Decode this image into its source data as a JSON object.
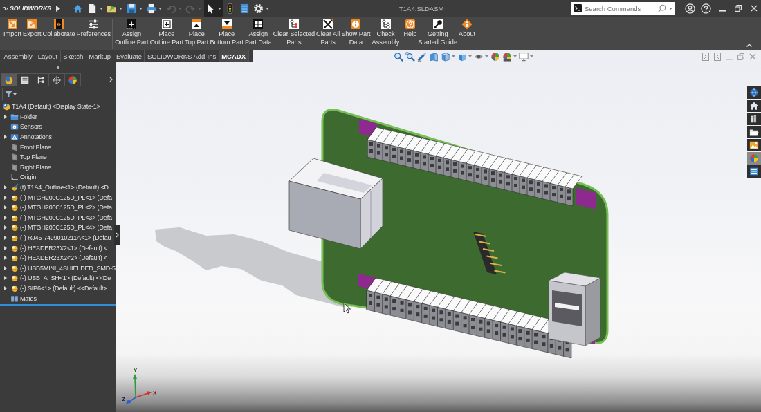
{
  "title_bar": {
    "app_name": "SOLIDWORKS",
    "quick_access": [
      {
        "disabled": false,
        "selected": false
      },
      {
        "disabled": false,
        "selected": false
      },
      {
        "disabled": false,
        "selected": false
      },
      {
        "disabled": false,
        "selected": false
      },
      {
        "disabled": false,
        "selected": false
      },
      {
        "disabled": true,
        "selected": false
      },
      {
        "disabled": true,
        "selected": false
      },
      {
        "disabled": false,
        "selected": true
      },
      {
        "disabled": false,
        "selected": false
      },
      {
        "disabled": false,
        "selected": false
      },
      {
        "disabled": false,
        "selected": false
      }
    ],
    "document_title": "T1A4.SLDASM",
    "search": {
      "placeholder": "Search Commands"
    }
  },
  "ribbon": {
    "groups": [
      {
        "buttons": [
          {
            "label": "Import"
          },
          {
            "label": "Export"
          },
          {
            "label": "Collaborate"
          },
          {
            "label": "Preferences"
          }
        ]
      },
      {
        "buttons": [
          {
            "label": "Assign\nOutline Part"
          },
          {
            "label": "Place\nOutline Part"
          },
          {
            "label": "Place\nTop Part"
          },
          {
            "label": "Place\nBottom Part"
          },
          {
            "label": "Assign\nPart Data"
          },
          {
            "label": "Clear Selected\nParts"
          },
          {
            "label": "Clear All\nParts"
          },
          {
            "label": "Show Part\nData"
          },
          {
            "label": "Check\nAssembly"
          }
        ]
      },
      {
        "buttons": [
          {
            "label": "Help"
          },
          {
            "label": "Getting\nStarted Guide"
          },
          {
            "label": "About"
          }
        ]
      }
    ]
  },
  "tabs": [
    {
      "label": "Assembly",
      "selected": false
    },
    {
      "label": "Layout",
      "selected": false
    },
    {
      "label": "Sketch",
      "selected": false
    },
    {
      "label": "Markup",
      "selected": false
    },
    {
      "label": "Evaluate",
      "selected": false
    },
    {
      "label": "SOLIDWORKS Add-Ins",
      "selected": false
    },
    {
      "label": "MCADX",
      "selected": true
    }
  ],
  "feature_manager": {
    "tabs": [
      {
        "selected": true
      },
      {
        "selected": false
      },
      {
        "selected": false
      },
      {
        "selected": false
      },
      {
        "selected": false
      }
    ],
    "tree": {
      "label": "T1A4 (Default) <Display State-1>",
      "kind": "assembly",
      "children": [
        {
          "label": "Folder",
          "kind": "folder",
          "expandable": true
        },
        {
          "label": "Sensors",
          "kind": "sensors",
          "expandable": false
        },
        {
          "label": "Annotations",
          "kind": "annotations",
          "expandable": true
        },
        {
          "label": "Front Plane",
          "kind": "plane",
          "expandable": false
        },
        {
          "label": "Top Plane",
          "kind": "plane",
          "expandable": false
        },
        {
          "label": "Right Plane",
          "kind": "plane",
          "expandable": false
        },
        {
          "label": "Origin",
          "kind": "origin",
          "expandable": false
        },
        {
          "label": "(f) T1A4_Outline<1> (Default) <D",
          "kind": "part",
          "expandable": true
        },
        {
          "label": "(-) MTGH200C125D_PL<1> (Defa",
          "kind": "component",
          "expandable": true
        },
        {
          "label": "(-) MTGH200C125D_PL<2> (Defa",
          "kind": "component",
          "expandable": true
        },
        {
          "label": "(-) MTGH200C125D_PL<3> (Defa",
          "kind": "component",
          "expandable": true
        },
        {
          "label": "(-) MTGH200C125D_PL<4> (Defa",
          "kind": "component",
          "expandable": true
        },
        {
          "label": "(-) RJ45-7499010211A<1> (Defau",
          "kind": "component",
          "expandable": true
        },
        {
          "label": "(-) HEADER23X2<1> (Default) <",
          "kind": "component",
          "expandable": true
        },
        {
          "label": "(-) HEADER23X2<2> (Default) <",
          "kind": "component",
          "expandable": true
        },
        {
          "label": "(-) USB5MINI_4SHIELDED_SMD-5",
          "kind": "component",
          "expandable": true
        },
        {
          "label": "(-) USB_A_SH<1> (Default) <<De",
          "kind": "component",
          "expandable": true
        },
        {
          "label": "(-) SIP6<1> (Default) <<Default>",
          "kind": "component",
          "expandable": true
        },
        {
          "label": "Mates",
          "kind": "mates",
          "expandable": false
        }
      ]
    }
  },
  "viewport": {
    "triad": {
      "x": "X",
      "y": "Y",
      "z": "Z"
    }
  },
  "task_pane": [
    {
      "selected": false
    },
    {
      "selected": false
    },
    {
      "selected": false
    },
    {
      "selected": false
    },
    {
      "selected": false
    },
    {
      "selected": true
    },
    {
      "selected": false
    }
  ]
}
